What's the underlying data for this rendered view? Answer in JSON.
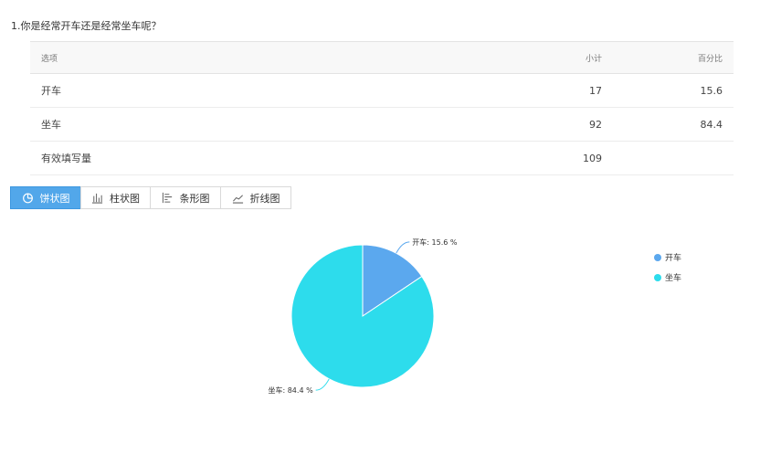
{
  "question": {
    "title": "1.你是经常开车还是经常坐车呢？"
  },
  "table": {
    "headers": {
      "option": "选项",
      "count": "小计",
      "percent": "百分比"
    },
    "rows": [
      {
        "option": "开车",
        "count": "17",
        "percent": "15.6"
      },
      {
        "option": "坐车",
        "count": "92",
        "percent": "84.4"
      },
      {
        "option": "有效填写量",
        "count": "109",
        "percent": ""
      }
    ]
  },
  "tabs": [
    {
      "label": "饼状图",
      "icon": "pie-chart-icon",
      "active": true
    },
    {
      "label": "柱状图",
      "icon": "bar-chart-icon",
      "active": false
    },
    {
      "label": "条形图",
      "icon": "horizontal-bar-chart-icon",
      "active": false
    },
    {
      "label": "折线图",
      "icon": "line-chart-icon",
      "active": false
    }
  ],
  "colors": {
    "accent": "#52a7ea",
    "series": [
      "#5ba8ee",
      "#2ddcec"
    ]
  },
  "chart_data": {
    "type": "pie",
    "categories": [
      "开车",
      "坐车"
    ],
    "values": [
      15.6,
      84.4
    ],
    "labels": [
      "开车: 15.6 %",
      "坐车: 84.4 %"
    ],
    "legend_position": "top-right"
  }
}
